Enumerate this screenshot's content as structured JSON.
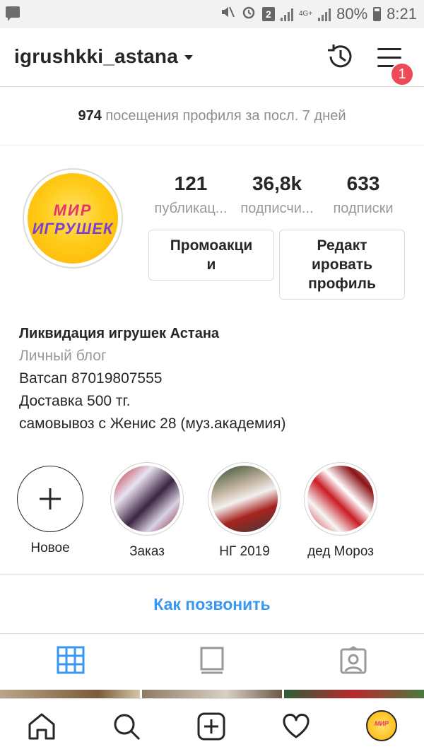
{
  "status_bar": {
    "battery": "80%",
    "time": "8:21",
    "sim_slot": "2",
    "network": "4G+"
  },
  "header": {
    "username": "igrushkki_astana",
    "notification_count": "1"
  },
  "insights": {
    "count": "974",
    "text": "посещения профиля за посл. 7 дней"
  },
  "profile": {
    "avatar_logo": [
      "МИР",
      "ИГРУШЕК"
    ],
    "stats": [
      {
        "value": "121",
        "label": "публикац..."
      },
      {
        "value": "36,8k",
        "label": "подписчи..."
      },
      {
        "value": "633",
        "label": "подписки"
      }
    ],
    "buttons": {
      "promo": [
        "Промоакци",
        "и"
      ],
      "edit": [
        "Редакт",
        "ировать",
        "профиль"
      ]
    },
    "bio": {
      "name": "Ликвидация игрушек Астана",
      "category": "Личный блог",
      "lines": [
        "Ватсап 87019807555",
        "Доставка 500 тг.",
        "самовывоз с Женис 28 (муз.академия)"
      ]
    }
  },
  "highlights": [
    {
      "label": "Новое"
    },
    {
      "label": "Заказ"
    },
    {
      "label": "НГ 2019"
    },
    {
      "label": "дед Мороз"
    }
  ],
  "call_button": "Как позвонить",
  "colors": {
    "accent": "#3897f0",
    "badge": "#ed4956",
    "text": "#262626",
    "muted": "#8e8e8e"
  }
}
